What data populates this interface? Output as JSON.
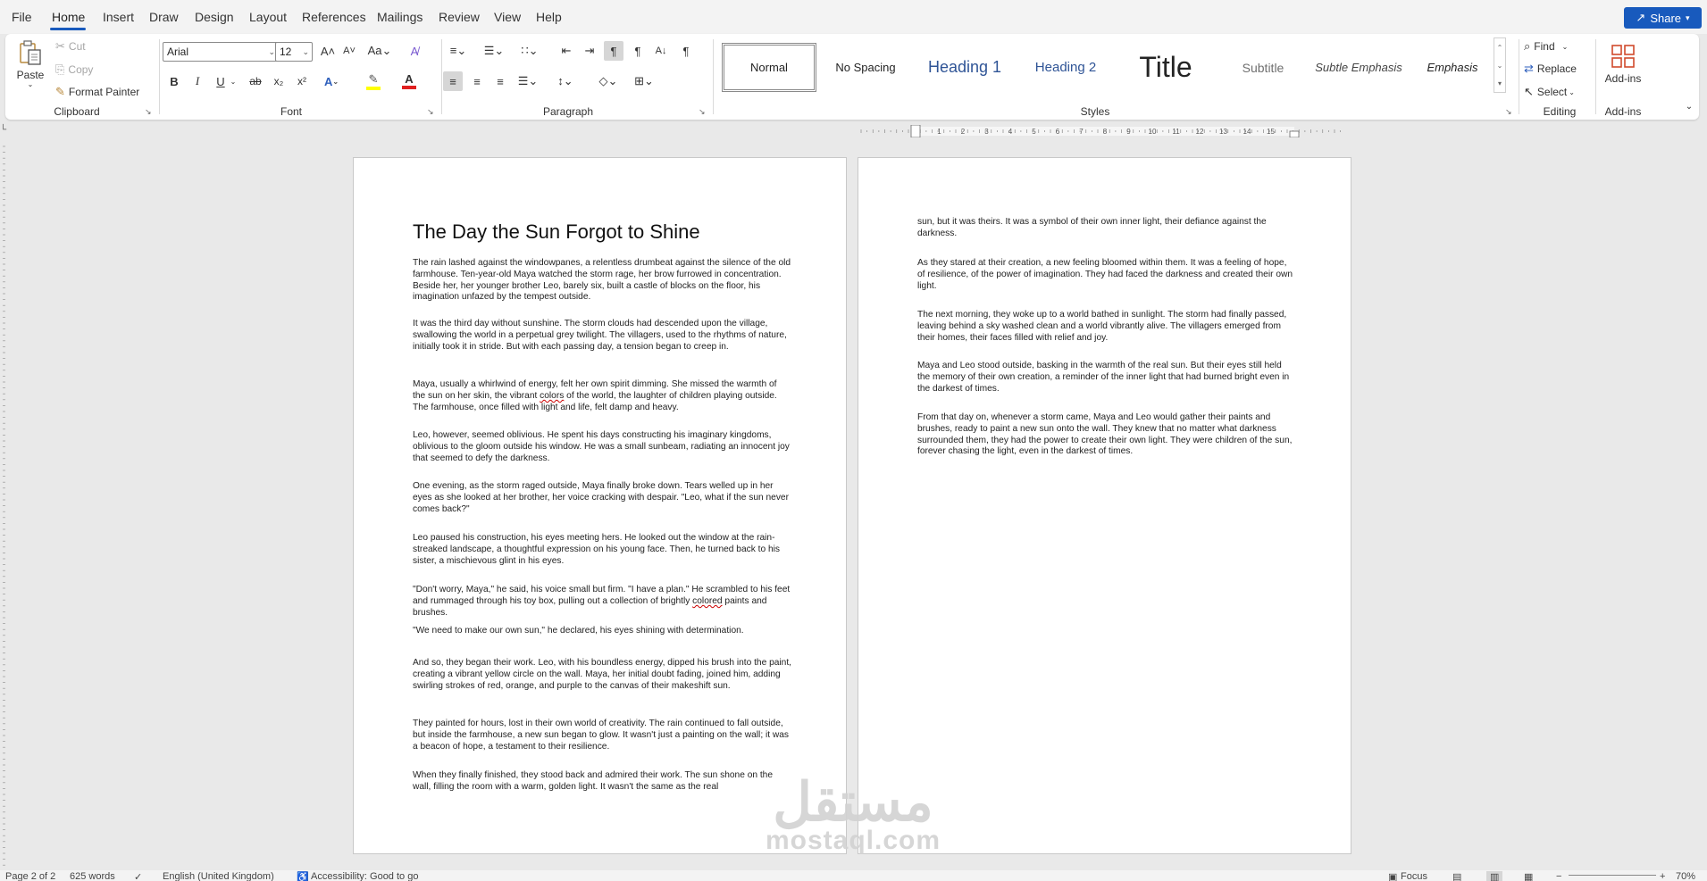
{
  "menu": {
    "items": [
      "File",
      "Home",
      "Insert",
      "Draw",
      "Design",
      "Layout",
      "References",
      "Mailings",
      "Review",
      "View",
      "Help"
    ],
    "share": "Share"
  },
  "ribbon": {
    "clipboard": {
      "paste": "Paste",
      "cut": "Cut",
      "copy": "Copy",
      "format_painter": "Format Painter",
      "label": "Clipboard"
    },
    "font": {
      "name": "Arial",
      "size": "12",
      "label": "Font",
      "font_color": "#e02020",
      "highlight_color": "#ffff00"
    },
    "paragraph": {
      "label": "Paragraph"
    },
    "styles": {
      "label": "Styles",
      "items": [
        {
          "label": "Normal"
        },
        {
          "label": "No Spacing"
        },
        {
          "label": "Heading 1"
        },
        {
          "label": "Heading 2"
        },
        {
          "label": "Title"
        },
        {
          "label": "Subtitle"
        },
        {
          "label": "Subtle Emphasis"
        },
        {
          "label": "Emphasis"
        }
      ]
    },
    "editing": {
      "find": "Find",
      "replace": "Replace",
      "select": "Select",
      "label": "Editing"
    },
    "addins": {
      "button": "Add-ins",
      "label": "Add-ins"
    }
  },
  "ruler": {
    "numbers": [
      "1",
      "2",
      "3",
      "4",
      "5",
      "6",
      "7",
      "8",
      "9",
      "10",
      "11",
      "12",
      "13",
      "14",
      "15"
    ]
  },
  "document": {
    "title": "The Day the Sun Forgot to Shine",
    "page1": [
      "The rain lashed against the windowpanes, a relentless drumbeat against the silence of the old farmhouse. Ten-year-old Maya watched the storm rage, her brow furrowed in concentration. Beside her, her younger brother Leo, barely six, built a castle of blocks on the floor, his imagination unfazed by the tempest outside.",
      "It was the third day without sunshine. The storm clouds had descended upon the village, swallowing the world in a perpetual grey twilight. The villagers, used to the rhythms of nature, initially took it in stride. But with each passing day, a tension began to creep in.",
      "Maya, usually a whirlwind of energy, felt her own spirit dimming. She missed the warmth of the sun on her skin, the vibrant colors of the world, the laughter of children playing outside. The farmhouse, once filled with light and life, felt damp and heavy.",
      "Leo, however, seemed oblivious. He spent his days constructing his imaginary kingdoms, oblivious to the gloom outside his window. He was a small sunbeam, radiating an innocent joy that seemed to defy the darkness.",
      "One evening, as the storm raged outside, Maya finally broke down. Tears welled up in her eyes as she looked at her brother, her voice cracking with despair. \"Leo, what if the sun never comes back?\"",
      "Leo paused his construction, his eyes meeting hers. He looked out the window at the rain-streaked landscape, a thoughtful expression on his young face. Then, he turned back to his sister, a mischievous glint in his eyes.",
      "\"Don't worry, Maya,\" he said, his voice small but firm. \"I have a plan.\" He scrambled to his feet and rummaged through his toy box, pulling out a collection of brightly colored paints and brushes.",
      "\"We need to make our own sun,\" he declared, his eyes shining with determination.",
      "And so, they began their work. Leo, with his boundless energy, dipped his brush into the paint, creating a vibrant yellow circle on the wall. Maya, her initial doubt fading, joined him, adding swirling strokes of red, orange, and purple to the canvas of their makeshift sun.",
      "They painted for hours, lost in their own world of creativity. The rain continued to fall outside, but inside the farmhouse, a new sun began to glow. It wasn't just a painting on the wall; it was a beacon of hope, a testament to their resilience.",
      "When they finally finished, they stood back and admired their work. The sun shone on the wall, filling the room with a warm, golden light. It wasn't the same as the real"
    ],
    "page2": [
      "sun, but it was theirs. It was a symbol of their own inner light, their defiance against the darkness.",
      "As they stared at their creation, a new feeling bloomed within them. It was a feeling of hope, of resilience, of the power of imagination. They had faced the darkness and created their own light.",
      "The next morning, they woke up to a world bathed in sunlight. The storm had finally passed, leaving behind a sky washed clean and a world vibrantly alive. The villagers emerged from their homes, their faces filled with relief and joy.",
      "Maya and Leo stood outside, basking in the warmth of the real sun. But their eyes still held the memory of their own creation, a reminder of the inner light that had burned bright even in the darkest of times.",
      "From that day on, whenever a storm came, Maya and Leo would gather their paints and brushes, ready to paint a new sun onto the wall. They knew that no matter what darkness surrounded them, they had the power to create their own light. They were children of the sun, forever chasing the light, even in the darkest of times."
    ]
  },
  "watermark": {
    "arabic": "مستقل",
    "latin": "mostaql.com"
  },
  "status": {
    "page": "Page 2 of 2",
    "words": "625 words",
    "language": "English (United Kingdom)",
    "accessibility": "Accessibility: Good to go",
    "focus": "Focus",
    "zoom": "70%"
  }
}
